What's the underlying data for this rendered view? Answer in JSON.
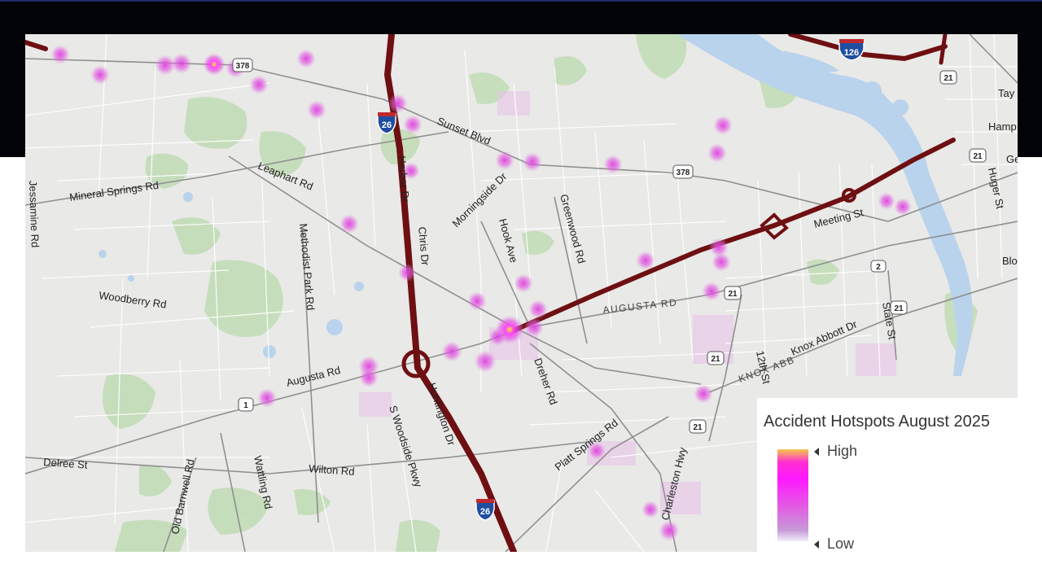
{
  "map": {
    "labels": {
      "mineral_springs": "Mineral Springs Rd",
      "leaphart": "Leaphart Rd",
      "sunset": "Sunset Blvd",
      "harbor": "Harbor Dr",
      "chris": "Chris Dr",
      "morningside": "Morningside Dr",
      "hook": "Hook Ave",
      "greenwood": "Greenwood Rd",
      "methodist": "Methodist Park Rd",
      "woodberry": "Woodberry Rd",
      "jessamine": "Jessamine Rd",
      "augusta_upper": "AUGUSTA RD",
      "augusta_lower": "Augusta Rd",
      "meeting": "Meeting St",
      "knox": "Knox Abbott Dr",
      "knox_caps": "KNOX ABB",
      "twelfth": "12th St",
      "state": "State St",
      "dreher": "Dreher Rd",
      "huntington": "Huntington Dr",
      "woodside": "S Woodside Pkwy",
      "platt": "Platt Springs Rd",
      "charleston": "Charleston Hwy",
      "delree": "Delree St",
      "wilton": "Wilton Rd",
      "old_barnwell": "Old Barnwell Rd",
      "wattling": "Wattling Rd",
      "huger": "Huger St",
      "hamp": "Hamp",
      "tay": "Tay",
      "ge": "Ge",
      "blo": "Blo"
    },
    "shields": {
      "i26": "26",
      "i126": "126",
      "us378": "378",
      "us21": "21",
      "us1": "1",
      "us2": "2"
    }
  },
  "legend": {
    "title": "Accident Hotspots August 2025",
    "high": "High",
    "low": "Low"
  }
}
